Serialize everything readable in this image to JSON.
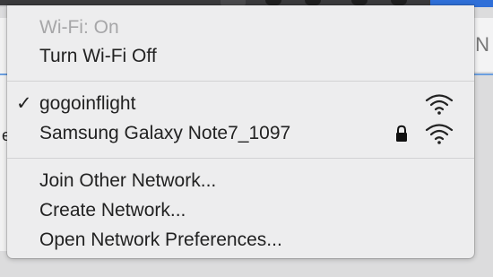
{
  "wifi_menu": {
    "status": "Wi-Fi: On",
    "toggle": "Turn Wi-Fi Off",
    "networks": [
      {
        "name": "gogoinflight",
        "connected": true,
        "check": "✓",
        "secured": false,
        "icon": "wifi-signal-icon"
      },
      {
        "name": "Samsung Galaxy Note7_1097",
        "connected": false,
        "secured": true,
        "lock_icon": "lock-icon",
        "icon": "wifi-signal-icon"
      }
    ],
    "actions": {
      "join_other": "Join Other Network...",
      "create": "Create Network...",
      "open_prefs": "Open Network Preferences..."
    }
  },
  "background": {
    "left_fragment": "e",
    "right_fragment": "N"
  },
  "colors": {
    "menu_bg": "#ededee",
    "text": "#222222",
    "disabled_text": "#a6a6a8",
    "separator": "#d2d2d4",
    "selected_menubar": "#2f6fd8"
  }
}
